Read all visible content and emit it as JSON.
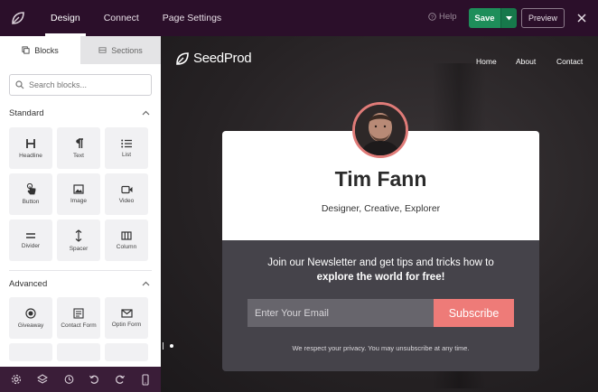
{
  "topbar": {
    "tabs": [
      {
        "label": "Design",
        "active": true
      },
      {
        "label": "Connect",
        "active": false
      },
      {
        "label": "Page Settings",
        "active": false
      }
    ],
    "help_label": "Help",
    "save_label": "Save",
    "preview_label": "Preview"
  },
  "sidebar": {
    "tabs": [
      {
        "label": "Blocks",
        "active": true
      },
      {
        "label": "Sections",
        "active": false
      }
    ],
    "search_placeholder": "Search blocks...",
    "standard": {
      "title": "Standard",
      "blocks": [
        {
          "label": "Headline",
          "icon": "heading-icon"
        },
        {
          "label": "Text",
          "icon": "paragraph-icon"
        },
        {
          "label": "List",
          "icon": "list-icon"
        },
        {
          "label": "Button",
          "icon": "pointer-hand-icon"
        },
        {
          "label": "Image",
          "icon": "image-icon"
        },
        {
          "label": "Video",
          "icon": "video-icon"
        },
        {
          "label": "Divider",
          "icon": "divider-icon"
        },
        {
          "label": "Spacer",
          "icon": "spacer-icon"
        },
        {
          "label": "Column",
          "icon": "column-icon"
        }
      ]
    },
    "advanced": {
      "title": "Advanced",
      "blocks": [
        {
          "label": "Giveaway",
          "icon": "giveaway-icon"
        },
        {
          "label": "Contact Form",
          "icon": "contact-form-icon"
        },
        {
          "label": "Optin Form",
          "icon": "envelope-icon"
        }
      ]
    }
  },
  "canvas": {
    "brand": "SeedProd",
    "nav": [
      "Home",
      "About",
      "Contact"
    ],
    "profile": {
      "name": "Tim Fann",
      "tagline": "Designer, Creative, Explorer"
    },
    "newsletter": {
      "line1": "Join our Newsletter and get tips and tricks how to",
      "line2": "explore the world for free!",
      "email_placeholder": "Enter Your Email",
      "subscribe_label": "Subscribe",
      "privacy": "We respect your privacy. You may unsubscribe at any time."
    }
  },
  "colors": {
    "topbar": "#2b0f2a",
    "save": "#1e8e5a",
    "subscribe": "#ee7b78",
    "card_bottom": "#45434a"
  }
}
